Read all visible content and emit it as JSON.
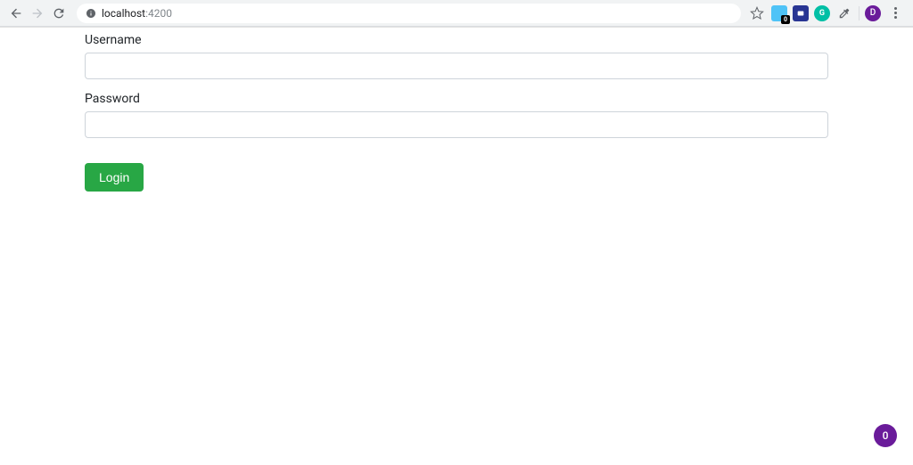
{
  "browser": {
    "url_host": "localhost",
    "url_port": ":4200",
    "avatar_letter": "D",
    "ext_badge_num": "0"
  },
  "form": {
    "username_label": "Username",
    "username_value": "",
    "password_label": "Password",
    "password_value": "",
    "login_label": "Login"
  },
  "floating": {
    "count": "0"
  }
}
